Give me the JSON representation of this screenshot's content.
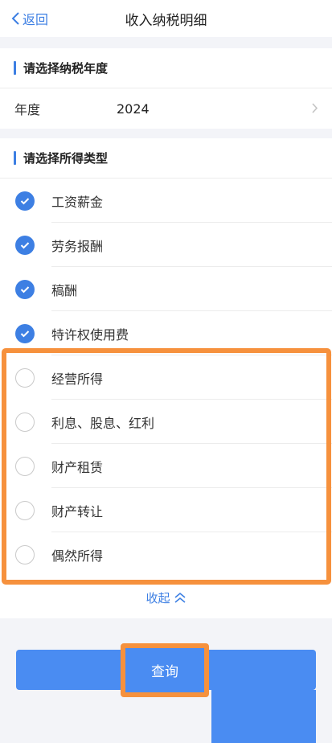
{
  "nav": {
    "back_label": "返回",
    "title": "收入纳税明细"
  },
  "year_section": {
    "heading": "请选择纳税年度",
    "field_label": "年度",
    "field_value": "2024"
  },
  "type_section": {
    "heading": "请选择所得类型",
    "options": [
      {
        "label": "工资薪金",
        "checked": true
      },
      {
        "label": "劳务报酬",
        "checked": true
      },
      {
        "label": "稿酬",
        "checked": true
      },
      {
        "label": "特许权使用费",
        "checked": true
      },
      {
        "label": "经营所得",
        "checked": false
      },
      {
        "label": "利息、股息、红利",
        "checked": false
      },
      {
        "label": "财产租赁",
        "checked": false
      },
      {
        "label": "财产转让",
        "checked": false
      },
      {
        "label": "偶然所得",
        "checked": false
      }
    ],
    "collapse_label": "收起"
  },
  "query_button": {
    "label": "查询"
  },
  "colors": {
    "accent": "#3d7fe3",
    "button": "#4a8cf2",
    "highlight": "#f6913d"
  }
}
